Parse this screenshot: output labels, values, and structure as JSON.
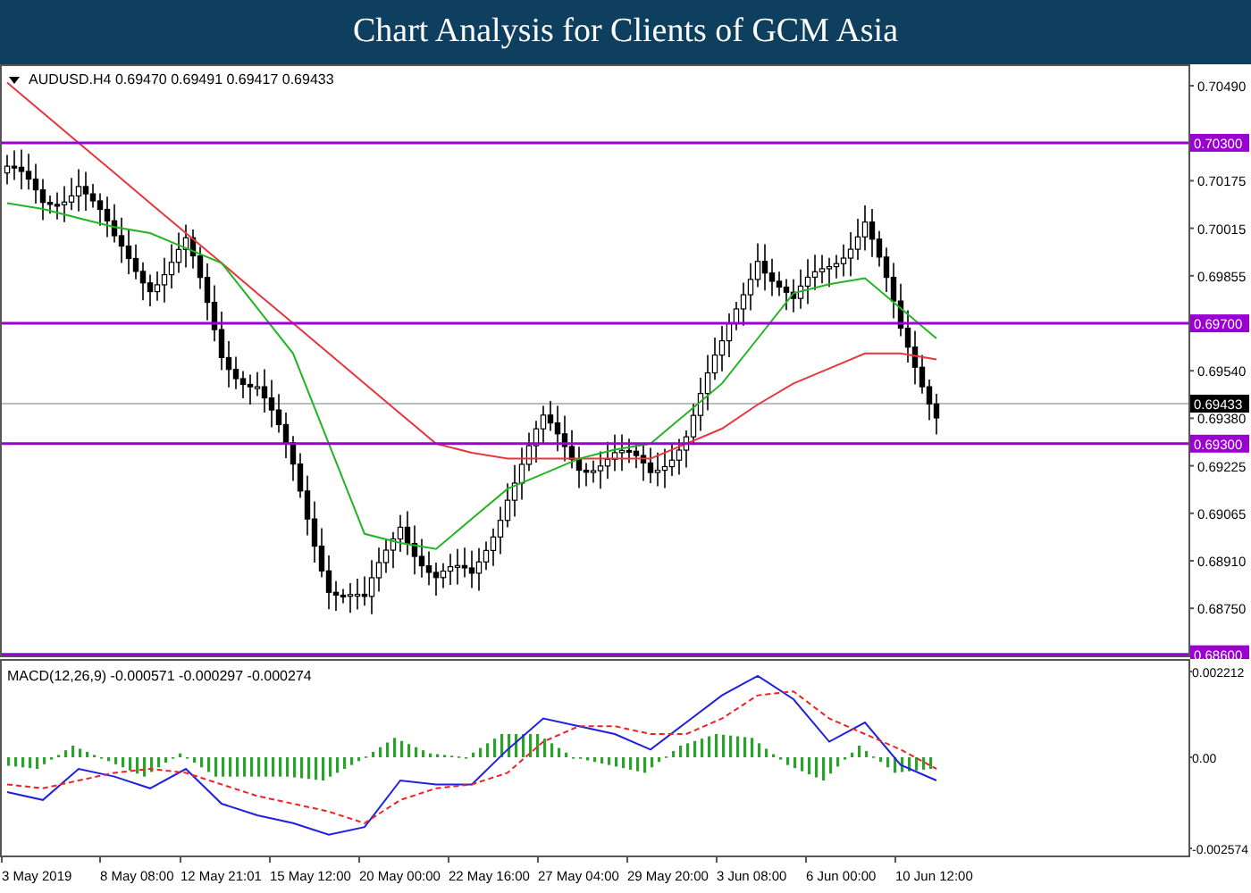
{
  "banner": {
    "title": "Chart Analysis for Clients of GCM Asia"
  },
  "price_panel": {
    "header": "AUDUSD.H4  0.69470 0.69491 0.69417 0.69433",
    "price_ticks": [
      "0.70490",
      "0.70175",
      "0.70015",
      "0.69855",
      "0.69540",
      "0.69380",
      "0.69225",
      "0.69065",
      "0.68910",
      "0.68750"
    ],
    "level_tags": [
      "0.70300",
      "0.69700",
      "0.69300",
      "0.68600"
    ],
    "current_price": "0.69433"
  },
  "macd_panel": {
    "header": "MACD(12,26,9) -0.000571 -0.000297 -0.000274",
    "value_ticks": [
      "0.002212",
      "0.00",
      "-0.002574"
    ],
    "date_ticks": [
      "3 May 2019",
      "8 May 08:00",
      "12 May 21:01",
      "15 May 12:00",
      "20 May 00:00",
      "22 May 16:00",
      "27 May 04:00",
      "29 May 20:00",
      "3 Jun 08:00",
      "6 Jun 00:00",
      "10 Jun 12:00"
    ]
  }
}
